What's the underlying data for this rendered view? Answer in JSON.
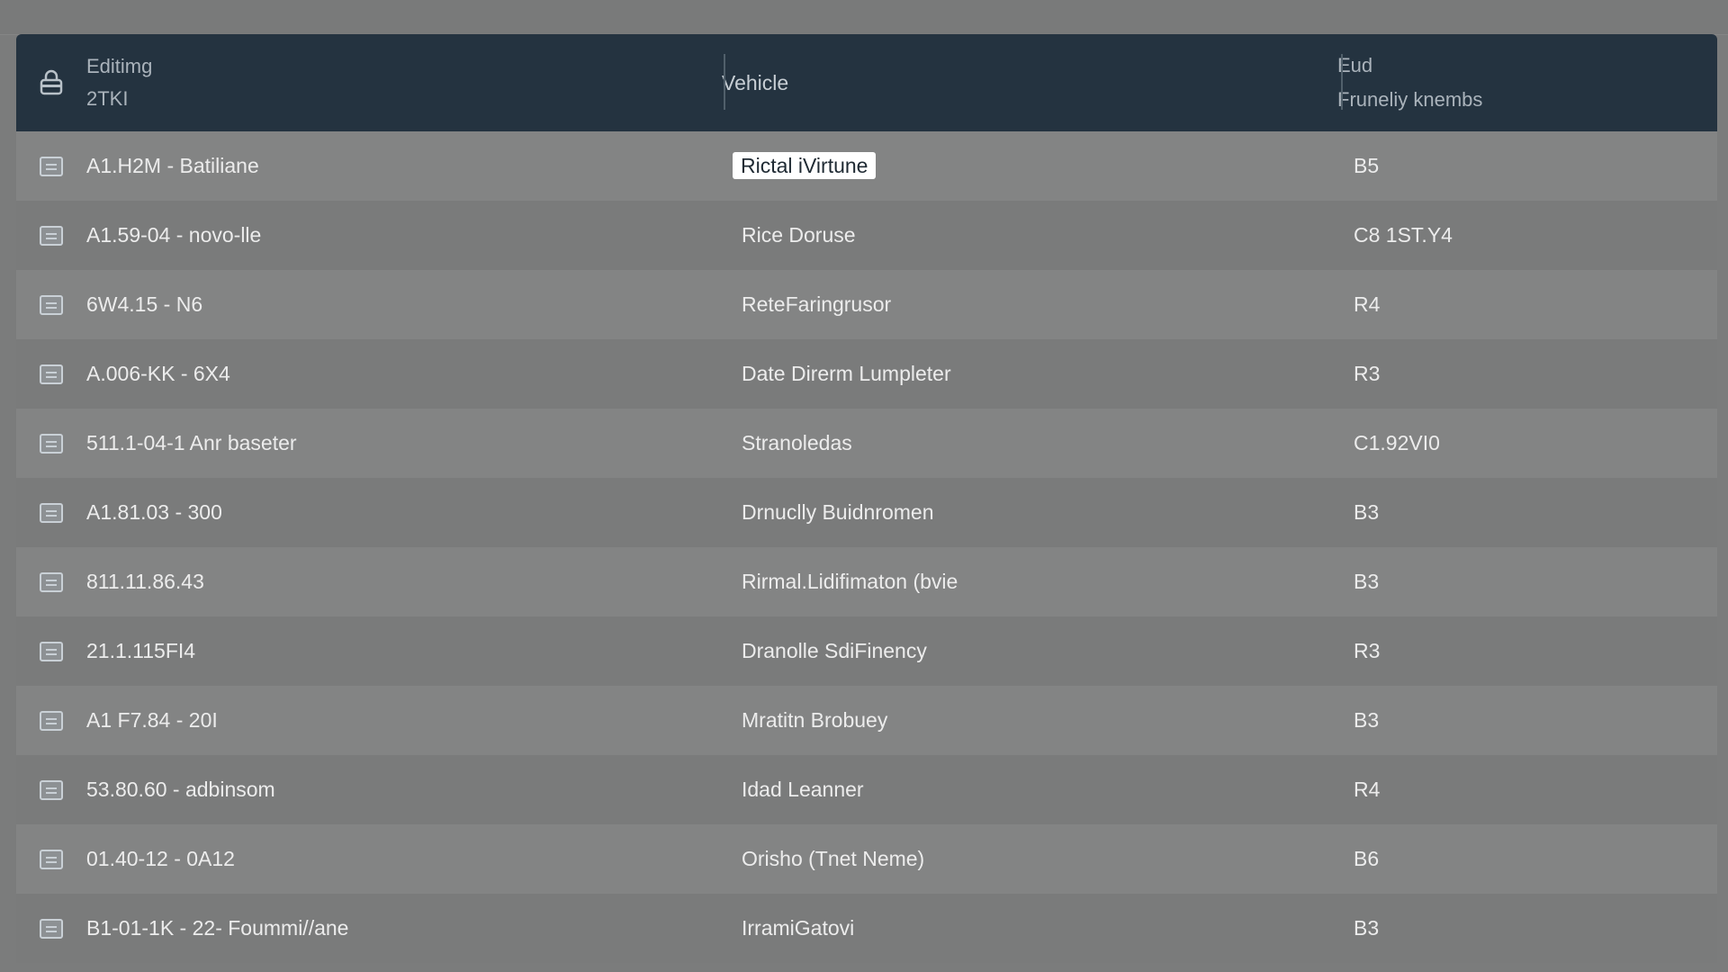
{
  "header": {
    "col1_title": "Editimg",
    "col1_sub": "2TKI",
    "col2_title": "Vehicle",
    "col3_title": "Eud",
    "col3_sub": "Fruneliy knembs",
    "lock_icon": "lock-icon"
  },
  "rows": [
    {
      "code": "A1.H2M - Batiliane",
      "vehicle": "Rictal iVirtune",
      "grade": "B5",
      "highlighted": true
    },
    {
      "code": "A1.59-04 - novo-lle",
      "vehicle": "Rice Doruse",
      "grade": "C8 1ST.Y4",
      "highlighted": false
    },
    {
      "code": "6W4.15 - N6",
      "vehicle": "ReteFaringrusor",
      "grade": "R4",
      "highlighted": false
    },
    {
      "code": "A.006-KK - 6X4",
      "vehicle": "Date Direrm Lumpleter",
      "grade": "R3",
      "highlighted": false
    },
    {
      "code": "511.1-04-1 Anr baseter",
      "vehicle": "Stranoledas",
      "grade": "C1.92VI0",
      "highlighted": false
    },
    {
      "code": "A1.81.03 - 300",
      "vehicle": "Drnuclly Buidnromen",
      "grade": "B3",
      "highlighted": false
    },
    {
      "code": "811.11.86.43",
      "vehicle": "Rirmal.Lidifimaton (bvie",
      "grade": "B3",
      "highlighted": false
    },
    {
      "code": "21.1.115FI4",
      "vehicle": "Dranolle SdiFinency",
      "grade": "R3",
      "highlighted": false
    },
    {
      "code": "A1 F7.84 - 20I",
      "vehicle": "Mratitn Brobuey",
      "grade": "B3",
      "highlighted": false
    },
    {
      "code": "53.80.60 - adbinsom",
      "vehicle": "Idad Leanner",
      "grade": "R4",
      "highlighted": false
    },
    {
      "code": "01.40-12 - 0A12",
      "vehicle": "Orisho (Tnet Neme)",
      "grade": "B6",
      "highlighted": false
    },
    {
      "code": "B1-01-1K - 22- Foummi//ane",
      "vehicle": "IrramiGatovi",
      "grade": "B3",
      "highlighted": false
    }
  ],
  "row_icon": "document-icon"
}
